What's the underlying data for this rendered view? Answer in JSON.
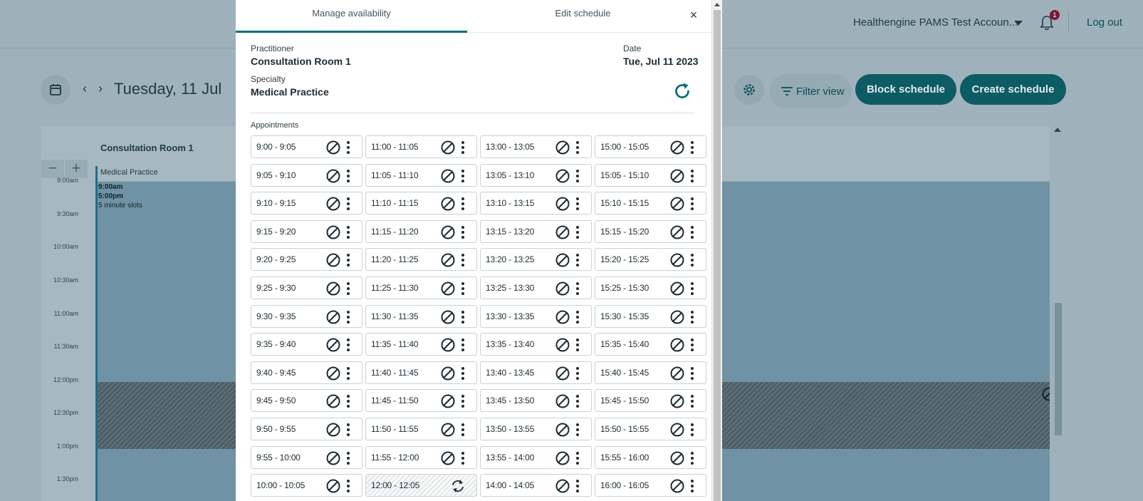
{
  "header": {
    "account_name": "Healthengine PAMS Test Accoun...",
    "notification_count": "1",
    "logout_label": "Log out"
  },
  "toolbar": {
    "date_title": "Tuesday, 11 Jul",
    "filter_label": "Filter view",
    "block_label": "Block schedule",
    "create_label": "Create schedule"
  },
  "calendar": {
    "room_name": "Consultation Room 1",
    "specialty_label": "Medical Practice",
    "block_start": "9:00am",
    "block_end": "5:00pm",
    "block_slots": "5 minute slots",
    "time_labels": [
      "9:00am",
      "9:30am",
      "10:00am",
      "10:30am",
      "11:00am",
      "11:30am",
      "12:00pm",
      "12:30pm",
      "1:00pm",
      "1:30pm"
    ]
  },
  "modal": {
    "tabs": [
      {
        "label": "Manage availability",
        "active": true
      },
      {
        "label": "Edit schedule",
        "active": false
      }
    ],
    "close_label": "×",
    "practitioner_label": "Practitioner",
    "practitioner_value": "Consultation Room 1",
    "date_label": "Date",
    "date_value": "Tue, Jul 11 2023",
    "specialty_label": "Specialty",
    "specialty_value": "Medical Practice",
    "appointments_label": "Appointments",
    "slot_columns": [
      [
        "9:00 - 9:05",
        "9:05 - 9:10",
        "9:10 - 9:15",
        "9:15 - 9:20",
        "9:20 - 9:25",
        "9:25 - 9:30",
        "9:30 - 9:35",
        "9:35 - 9:40",
        "9:40 - 9:45",
        "9:45 - 9:50",
        "9:50 - 9:55",
        "9:55 - 10:00",
        "10:00 - 10:05"
      ],
      [
        "11:00 - 11:05",
        "11:05 - 11:10",
        "11:10 - 11:15",
        "11:15 - 11:20",
        "11:20 - 11:25",
        "11:25 - 11:30",
        "11:30 - 11:35",
        "11:35 - 11:40",
        "11:40 - 11:45",
        "11:45 - 11:50",
        "11:50 - 11:55",
        "11:55 - 12:00",
        "12:00 - 12:05"
      ],
      [
        "13:00 - 13:05",
        "13:05 - 13:10",
        "13:10 - 13:15",
        "13:15 - 13:20",
        "13:20 - 13:25",
        "13:25 - 13:30",
        "13:30 - 13:35",
        "13:35 - 13:40",
        "13:40 - 13:45",
        "13:45 - 13:50",
        "13:50 - 13:55",
        "13:55 - 14:00",
        "14:00 - 14:05"
      ],
      [
        "15:00 - 15:05",
        "15:05 - 15:10",
        "15:10 - 15:15",
        "15:15 - 15:20",
        "15:20 - 15:25",
        "15:25 - 15:30",
        "15:30 - 15:35",
        "15:35 - 15:40",
        "15:40 - 15:45",
        "15:45 - 15:50",
        "15:50 - 15:55",
        "15:55 - 16:00",
        "16:00 - 16:05"
      ]
    ],
    "blocked_slots": [
      "12:00 - 12:05"
    ]
  },
  "colors": {
    "accent": "#0d6e78",
    "button": "#0d5c63",
    "badge": "#7a1c34",
    "overlay": "#9fb2bb",
    "schedule_block": "#6f93a4"
  },
  "icons": {
    "slot_available": "block-icon",
    "slot_blocked": "recurring-icon",
    "slot_menu": "more-vertical-icon",
    "refresh": "refresh-icon"
  }
}
